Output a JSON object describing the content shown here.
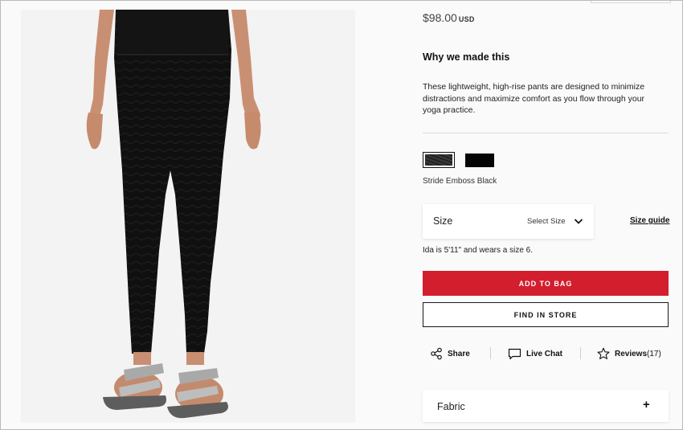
{
  "product": {
    "price": "$98.00",
    "currency": "USD",
    "why_heading": "Why we made this",
    "description": "These lightweight, high-rise pants are designed to minimize distractions and maximize comfort as you flow through your yoga practice.",
    "swatches": [
      "#2a2a2a",
      "#050505"
    ],
    "color_name": "Stride Emboss Black"
  },
  "size": {
    "label": "Size",
    "placeholder": "Select Size",
    "guide": "Size guide",
    "model_note": "Ida is 5'11\" and wears a size 6."
  },
  "buttons": {
    "add_to_bag": "ADD TO BAG",
    "find_in_store": "FIND IN STORE"
  },
  "actions": {
    "share": "Share",
    "live_chat": "Live Chat",
    "reviews": "Reviews",
    "reviews_count": "(17)"
  },
  "accordion": {
    "fabric_label": "Fabric",
    "expand_symbol": "+"
  },
  "icons": [
    "share-icon",
    "chat-icon",
    "star-icon",
    "chevron-down-icon"
  ],
  "colors": {
    "accent": "#d31e2e",
    "text": "#1a1a1a",
    "background": "#fafafa"
  }
}
